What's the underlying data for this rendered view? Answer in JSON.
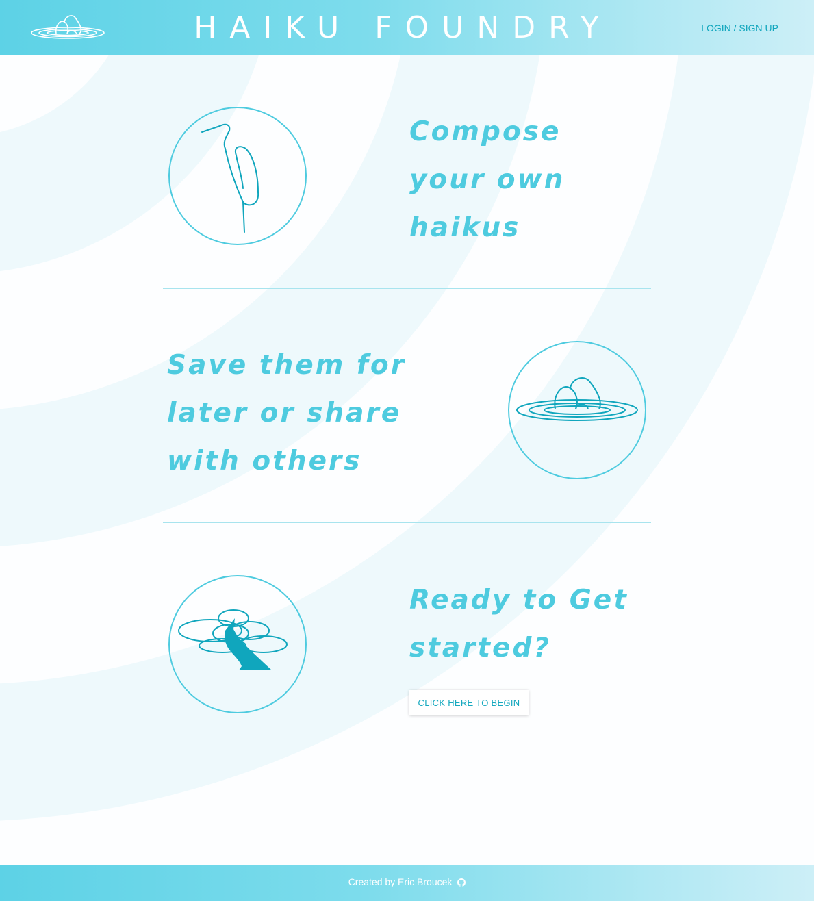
{
  "header": {
    "title": "HAIKU FOUNDRY",
    "login_label": "LOGIN / SIGN UP",
    "logo_icon": "stones-in-water-icon"
  },
  "features": [
    {
      "text": "Compose your own haikus",
      "icon": "heron-icon"
    },
    {
      "text": "Save them for later or share with others",
      "icon": "stones-in-water-icon"
    },
    {
      "text": "Ready to Get started?",
      "icon": "bonsai-tree-icon"
    }
  ],
  "cta": {
    "label": "CLICK HERE TO BEGIN"
  },
  "footer": {
    "credit": "Created by Eric Broucek",
    "icon": "github-icon"
  },
  "colors": {
    "accent": "#4ecbdf",
    "accent_dark": "#10a6bd",
    "header_gradient_start": "#5dd2e6",
    "header_gradient_end": "#cdeff7",
    "divider": "#a8e4ee"
  }
}
